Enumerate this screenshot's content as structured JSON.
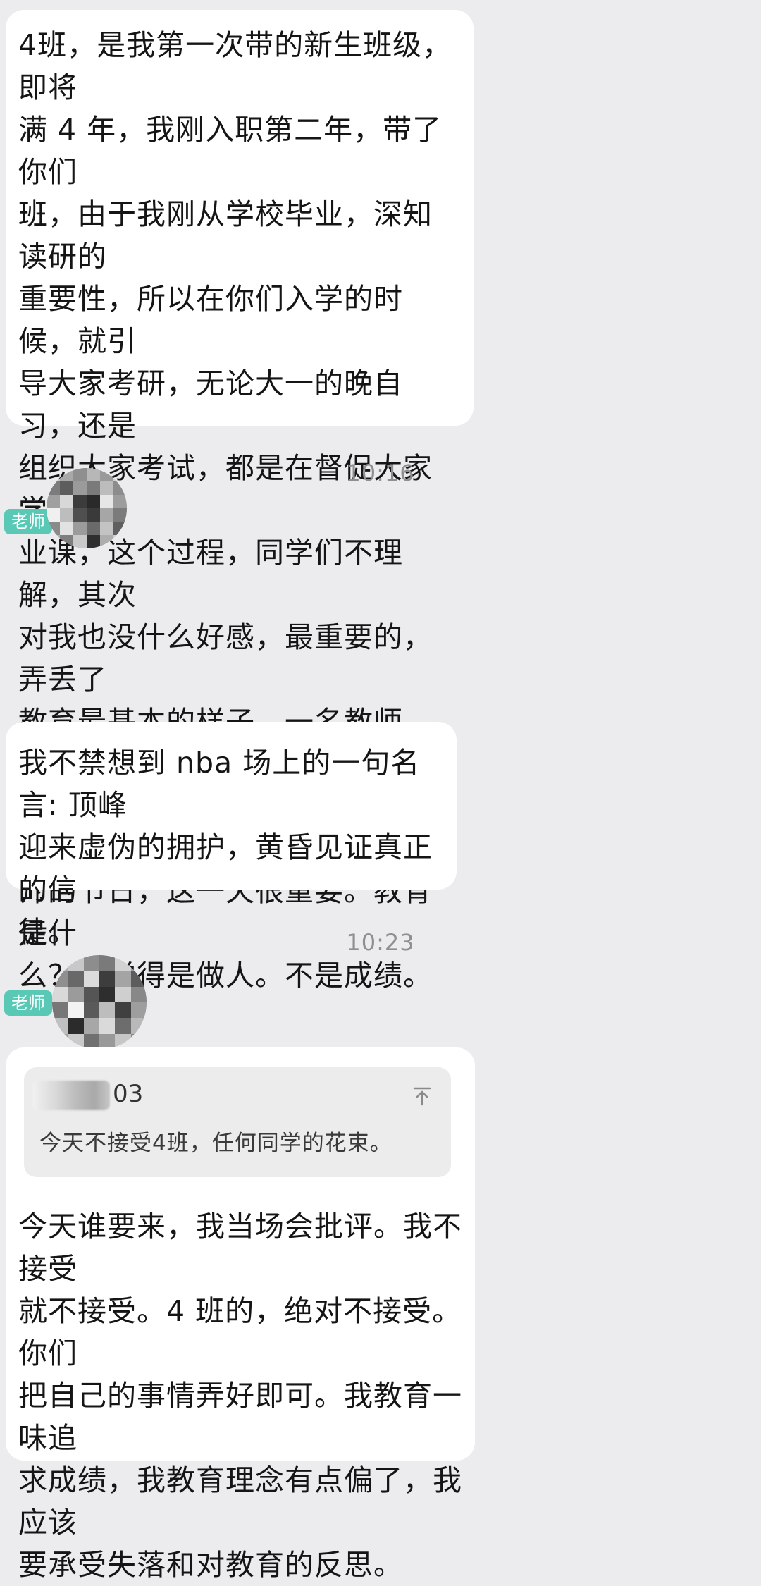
{
  "messages": {
    "first": {
      "text": "4班，是我第一次带的新生班级，即将\n满 4 年，我刚入职第二年，带了你们\n班，由于我刚从学校毕业，深知读研的\n重要性，所以在你们入学的时候，就引\n导大家考研，无论大一的晚自习，还是\n组织大家考试，都是在督促大家学好专\n业课，这个过程，同学们不理解，其次\n对我也没什么好感，最重要的，弄丢了\n教育最基本的样子，一名教师，最重要\n的节日是教师节，这是国家给予全体教\n师的节日，这一天很重要。教育是什\n么？我觉得是做人。不是成绩。"
    },
    "time1": "10:16",
    "second": {
      "badge": "老师",
      "text": "我不禁想到 nba 场上的一句名言: 顶峰\n迎来虚伪的拥护，黄昏见证真正的信\n徒。"
    },
    "time2": "10:23",
    "third": {
      "badge": "老师",
      "quote_name_suffix": "03",
      "quote_text": "今天不接受4班，任何同学的花束。",
      "text": "今天谁要来，我当场会批评。我不接受\n就不接受。4 班的，绝对不接受。你们\n把自己的事情弄好即可。我教育一味追\n求成绩，我教育理念有点偏了，我应该\n要承受失落和对教育的反思。"
    }
  },
  "icons": {
    "avatar": "pixelated-avatar-icon",
    "quote_pin": "pin-to-top-icon"
  },
  "colors": {
    "background": "#ececee",
    "bubble": "#ffffff",
    "badge": "#59c9b6",
    "timestamp": "#8e8e93"
  }
}
